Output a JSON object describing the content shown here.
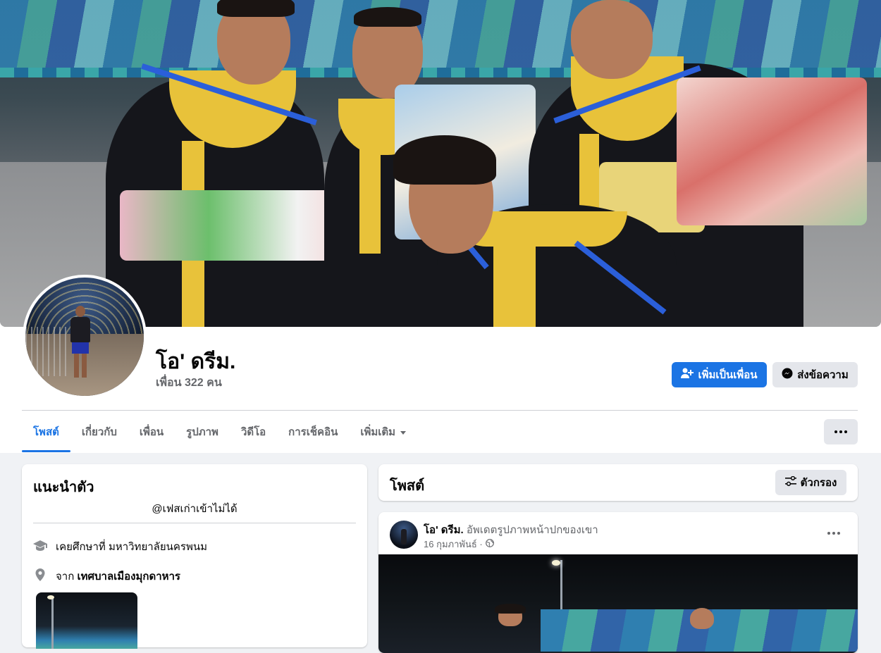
{
  "profile": {
    "name": "โอ' ดรีม.",
    "friends_label": "เพื่อน 322 คน"
  },
  "actions": {
    "add_friend": "เพิ่มเป็นเพื่อน",
    "message": "ส่งข้อความ"
  },
  "tabs": [
    {
      "label": "โพสต์",
      "active": true
    },
    {
      "label": "เกี่ยวกับ"
    },
    {
      "label": "เพื่อน"
    },
    {
      "label": "รูปภาพ"
    },
    {
      "label": "วิดีโอ"
    },
    {
      "label": "การเช็คอิน"
    },
    {
      "label": "เพิ่มเติม"
    }
  ],
  "intro": {
    "title": "แนะนำตัว",
    "bio": "@เฟสเก่าเข้าไม่ได้",
    "studied_prefix": "เคยศึกษาที่",
    "studied_value": "มหาวิทยาลัยนครพนม",
    "from_prefix": "จาก",
    "from_value": "เทศบาลเมืองมุกดาหาร"
  },
  "posts_header": {
    "title": "โพสต์",
    "filter_label": "ตัวกรอง"
  },
  "post": {
    "author": "โอ' ดรีม.",
    "action": "อัพเดตรูปภาพหน้าปกของเขา",
    "date": "16 กุมภาพันธ์ ·"
  },
  "icons": {
    "add_friend": "person-plus-icon",
    "message": "messenger-icon",
    "more": "ellipsis-icon",
    "dropdown": "caret-down-icon",
    "filter": "sliders-icon",
    "education": "graduation-cap-icon",
    "location": "map-pin-icon",
    "privacy": "globe-icon"
  },
  "colors": {
    "accent": "#1b74e4",
    "secondary_text": "#65676b",
    "button_grey": "#e4e6eb",
    "page_bg": "#f0f2f5"
  }
}
